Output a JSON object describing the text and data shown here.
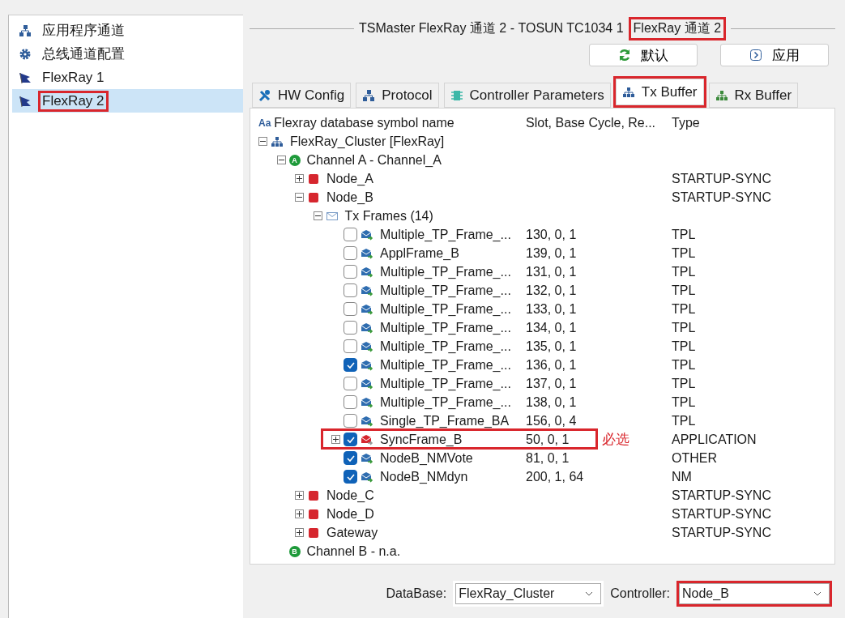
{
  "sidebar": {
    "items": [
      {
        "label": "应用程序通道",
        "selected": false,
        "annotated": false
      },
      {
        "label": "总线通道配置",
        "selected": false,
        "annotated": false
      },
      {
        "label": "FlexRay 1",
        "selected": false,
        "annotated": false
      },
      {
        "label": "FlexRay 2",
        "selected": true,
        "annotated": true
      }
    ]
  },
  "title": {
    "text": "TSMaster FlexRay 通道 2 - TOSUN TC1034 1",
    "highlight": "FlexRay 通道 2"
  },
  "buttons": [
    {
      "label": "默认"
    },
    {
      "label": "应用"
    }
  ],
  "tabs": [
    {
      "label": "HW Config",
      "selected": false,
      "annotated": false
    },
    {
      "label": "Protocol",
      "selected": false,
      "annotated": false
    },
    {
      "label": "Controller Parameters",
      "selected": false,
      "annotated": false
    },
    {
      "label": "Tx Buffer",
      "selected": true,
      "annotated": true
    },
    {
      "label": "Rx Buffer",
      "selected": false,
      "annotated": false
    }
  ],
  "header_icon": "Aa",
  "columns": [
    "Flexray database symbol name",
    "Slot, Base Cycle, Re...",
    "Type"
  ],
  "tree": [
    {
      "kind": "cluster",
      "name": "FlexRay_Cluster [FlexRay]",
      "expanded": true,
      "children": [
        {
          "kind": "channel",
          "badge": "A",
          "name": "Channel A - Channel_A",
          "expanded": true,
          "children": [
            {
              "kind": "node",
              "name": "Node_A",
              "type": "STARTUP-SYNC",
              "expanded": false
            },
            {
              "kind": "node",
              "name": "Node_B",
              "type": "STARTUP-SYNC",
              "expanded": true,
              "children": [
                {
                  "kind": "folder",
                  "name": "Tx Frames (14)",
                  "expanded": true,
                  "children": [
                    {
                      "kind": "frame",
                      "name": "Multiple_TP_Frame_...",
                      "slot": "130, 0, 1",
                      "type": "TPL",
                      "checked": false
                    },
                    {
                      "kind": "frame",
                      "name": "ApplFrame_B",
                      "slot": "139, 0, 1",
                      "type": "TPL",
                      "checked": false
                    },
                    {
                      "kind": "frame",
                      "name": "Multiple_TP_Frame_...",
                      "slot": "131, 0, 1",
                      "type": "TPL",
                      "checked": false
                    },
                    {
                      "kind": "frame",
                      "name": "Multiple_TP_Frame_...",
                      "slot": "132, 0, 1",
                      "type": "TPL",
                      "checked": false
                    },
                    {
                      "kind": "frame",
                      "name": "Multiple_TP_Frame_...",
                      "slot": "133, 0, 1",
                      "type": "TPL",
                      "checked": false
                    },
                    {
                      "kind": "frame",
                      "name": "Multiple_TP_Frame_...",
                      "slot": "134, 0, 1",
                      "type": "TPL",
                      "checked": false
                    },
                    {
                      "kind": "frame",
                      "name": "Multiple_TP_Frame_...",
                      "slot": "135, 0, 1",
                      "type": "TPL",
                      "checked": false
                    },
                    {
                      "kind": "frame",
                      "name": "Multiple_TP_Frame_...",
                      "slot": "136, 0, 1",
                      "type": "TPL",
                      "checked": true
                    },
                    {
                      "kind": "frame",
                      "name": "Multiple_TP_Frame_...",
                      "slot": "137, 0, 1",
                      "type": "TPL",
                      "checked": false
                    },
                    {
                      "kind": "frame",
                      "name": "Multiple_TP_Frame_...",
                      "slot": "138, 0, 1",
                      "type": "TPL",
                      "checked": false
                    },
                    {
                      "kind": "frame",
                      "name": "Single_TP_Frame_BA",
                      "slot": "156, 0, 4",
                      "type": "TPL",
                      "checked": false
                    },
                    {
                      "kind": "sync_frame",
                      "name": "SyncFrame_B",
                      "slot": "50, 0, 1",
                      "type": "APPLICATION",
                      "checked": true,
                      "expanded": false,
                      "annotation": "必选"
                    },
                    {
                      "kind": "frame",
                      "name": "NodeB_NMVote",
                      "slot": "81, 0, 1",
                      "type": "OTHER",
                      "checked": true
                    },
                    {
                      "kind": "frame",
                      "name": "NodeB_NMdyn",
                      "slot": "200, 1, 64",
                      "type": "NM",
                      "checked": true
                    }
                  ]
                }
              ]
            },
            {
              "kind": "node",
              "name": "Node_C",
              "type": "STARTUP-SYNC",
              "expanded": false
            },
            {
              "kind": "node",
              "name": "Node_D",
              "type": "STARTUP-SYNC",
              "expanded": false
            },
            {
              "kind": "node",
              "name": "Gateway",
              "type": "STARTUP-SYNC",
              "expanded": false
            }
          ]
        },
        {
          "kind": "channel",
          "badge": "B",
          "name": "Channel B - n.a."
        }
      ]
    }
  ],
  "footer": {
    "database_label": "DataBase:",
    "database": {
      "value": "FlexRay_Cluster",
      "annotated": false
    },
    "controller_label": "Controller:",
    "controller": {
      "value": "Node_B",
      "annotated": true
    }
  }
}
